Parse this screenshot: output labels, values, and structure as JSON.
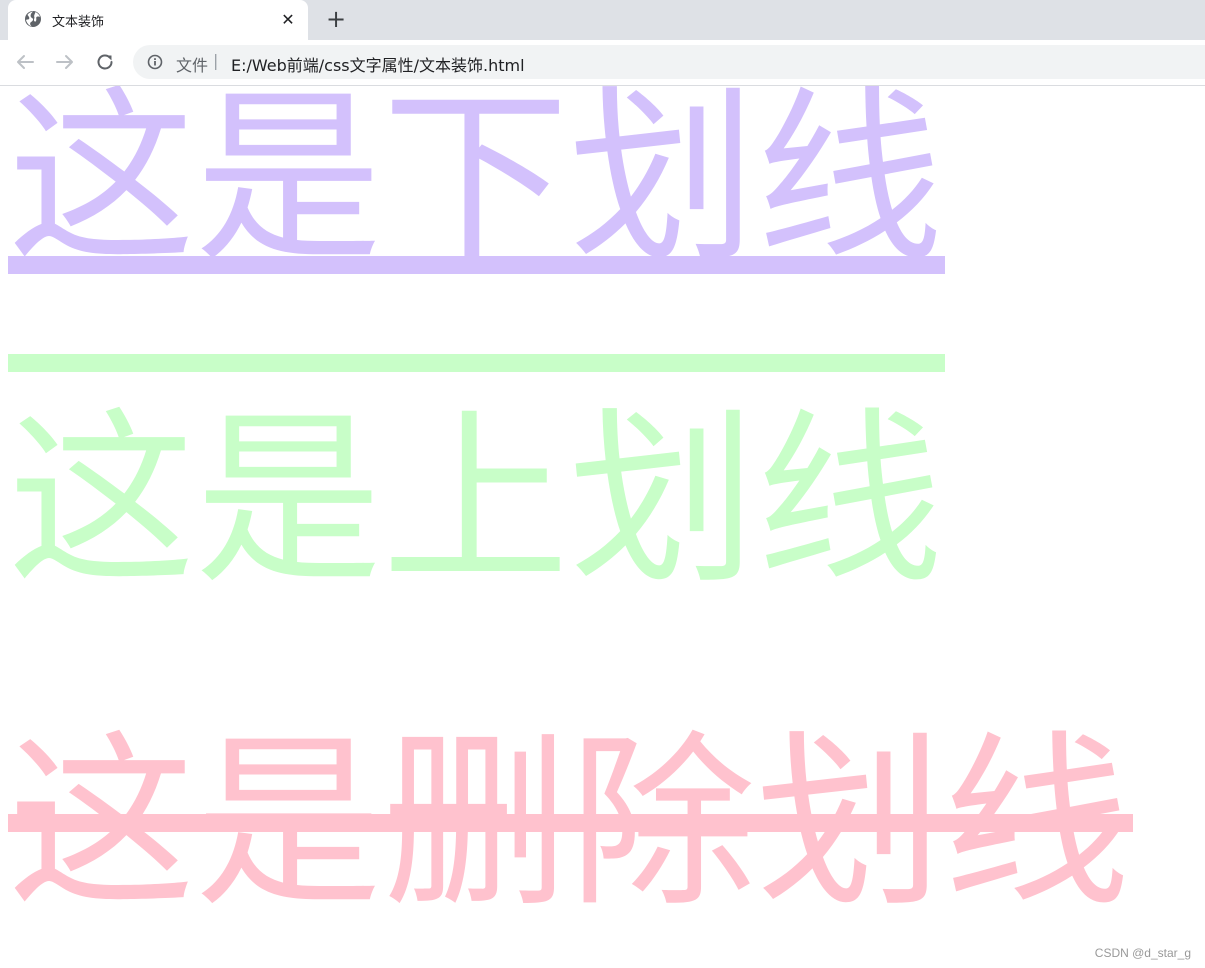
{
  "tab": {
    "title": "文本装饰",
    "close_label": "✕",
    "new_tab_label": "+"
  },
  "address_bar": {
    "scheme_label": "文件",
    "separator": "|",
    "url": "E:/Web前端/css文字属性/文本装饰.html"
  },
  "page": {
    "lines": [
      {
        "text": "这是下划线",
        "decoration": "underline",
        "color": "#d3c1fc"
      },
      {
        "text": "这是上划线",
        "decoration": "overline",
        "color": "#c8fec8"
      },
      {
        "text": "这是删除划线",
        "decoration": "line-through",
        "color": "#ffc2ce"
      }
    ]
  },
  "watermark": "CSDN @d_star_g",
  "colors": {
    "tabbar_bg": "#dee1e6",
    "omnibox_bg": "#f1f3f4",
    "underline_color": "#d3c1fc",
    "overline_color": "#c8fec8",
    "linethrough_color": "#ffc2ce"
  }
}
